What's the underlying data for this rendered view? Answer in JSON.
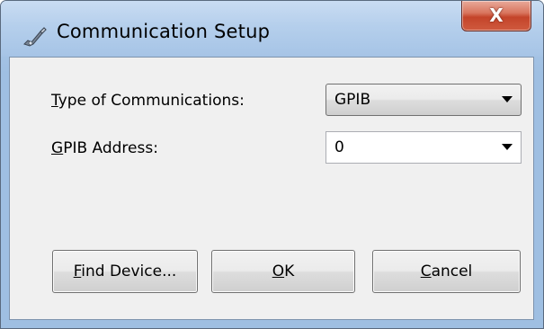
{
  "window": {
    "title": "Communication Setup",
    "close_label": "X",
    "icon": "instrument-probe-icon"
  },
  "form": {
    "type_label": {
      "mnemonic": "T",
      "rest": "ype of Communications:"
    },
    "type_value": "GPIB",
    "address_label": {
      "mnemonic": "G",
      "rest": "PIB Address:"
    },
    "address_value": "0"
  },
  "buttons": {
    "find": {
      "mnemonic": "F",
      "rest": "ind Device..."
    },
    "ok": {
      "mnemonic": "O",
      "rest": "K"
    },
    "cancel": {
      "mnemonic": "C",
      "rest": "ancel"
    }
  },
  "colors": {
    "title_bar": "#b5cfec",
    "close_button": "#c4442a",
    "client_background": "#f0f0f0"
  }
}
